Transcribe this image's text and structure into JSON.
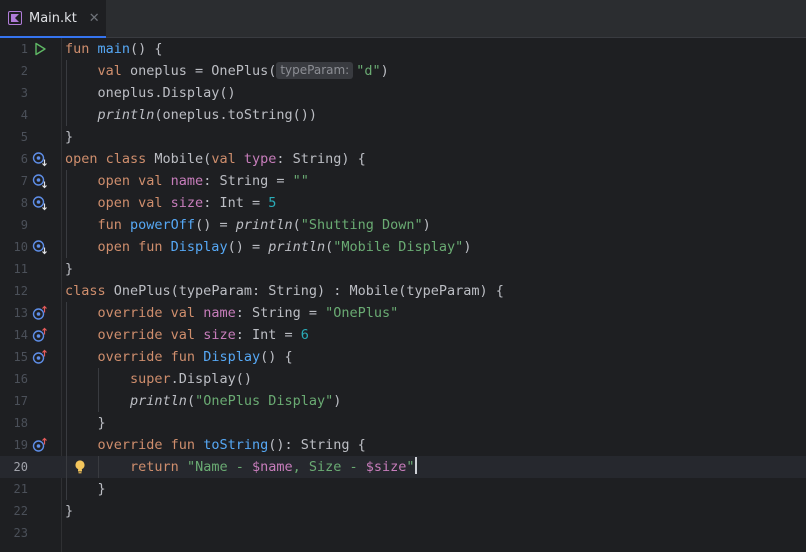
{
  "tab": {
    "filename": "Main.kt",
    "close_glyph": "✕"
  },
  "gutter_icons": {
    "run": "run-gutter-icon",
    "overridden": "overridden-by-icon",
    "overriding": "overrides-icon",
    "intention": "lightbulb-icon"
  },
  "colors": {
    "keyword": "#cf8e6d",
    "function": "#56a8f5",
    "property": "#c77dbb",
    "string": "#6aab73",
    "number": "#2aacb8",
    "text": "#bcbec4",
    "background": "#1e1f22"
  },
  "lines": [
    {
      "n": "1",
      "segments": [
        [
          "kw",
          "fun "
        ],
        [
          "fn",
          "main"
        ],
        [
          "",
          "() {"
        ]
      ]
    },
    {
      "n": "2",
      "segments": [
        [
          "",
          "    "
        ],
        [
          "kw",
          "val "
        ],
        [
          "",
          "oneplus = OnePlus("
        ],
        [
          "hint",
          "typeParam:"
        ],
        [
          "str",
          "\"d\""
        ],
        [
          "",
          ")"
        ]
      ]
    },
    {
      "n": "3",
      "segments": [
        [
          "",
          "    oneplus.Display()"
        ]
      ]
    },
    {
      "n": "4",
      "segments": [
        [
          "",
          "    "
        ],
        [
          "it",
          "println"
        ],
        [
          "",
          "(oneplus.toString())"
        ]
      ]
    },
    {
      "n": "5",
      "segments": [
        [
          "",
          "}"
        ]
      ]
    },
    {
      "n": "6",
      "segments": [
        [
          "kw",
          "open class "
        ],
        [
          "",
          "Mobile("
        ],
        [
          "kw",
          "val "
        ],
        [
          "prop",
          "type"
        ],
        [
          "",
          ": String) {"
        ]
      ]
    },
    {
      "n": "7",
      "segments": [
        [
          "",
          "    "
        ],
        [
          "kw",
          "open val "
        ],
        [
          "prop",
          "name"
        ],
        [
          "",
          ": String = "
        ],
        [
          "str",
          "\"\""
        ]
      ]
    },
    {
      "n": "8",
      "segments": [
        [
          "",
          "    "
        ],
        [
          "kw",
          "open val "
        ],
        [
          "prop",
          "size"
        ],
        [
          "",
          ": Int = "
        ],
        [
          "num",
          "5"
        ]
      ]
    },
    {
      "n": "9",
      "segments": [
        [
          "",
          "    "
        ],
        [
          "kw",
          "fun "
        ],
        [
          "fn",
          "powerOff"
        ],
        [
          "",
          "() = "
        ],
        [
          "it",
          "println"
        ],
        [
          "",
          "("
        ],
        [
          "str",
          "\"Shutting Down\""
        ],
        [
          "",
          ")"
        ]
      ]
    },
    {
      "n": "10",
      "segments": [
        [
          "",
          "    "
        ],
        [
          "kw",
          "open fun "
        ],
        [
          "fn",
          "Display"
        ],
        [
          "",
          "() = "
        ],
        [
          "it",
          "println"
        ],
        [
          "",
          "("
        ],
        [
          "str",
          "\"Mobile Display\""
        ],
        [
          "",
          ")"
        ]
      ]
    },
    {
      "n": "11",
      "segments": [
        [
          "",
          "}"
        ]
      ]
    },
    {
      "n": "12",
      "segments": [
        [
          "kw",
          "class "
        ],
        [
          "",
          "OnePlus(typeParam: String) : Mobile(typeParam) {"
        ]
      ]
    },
    {
      "n": "13",
      "segments": [
        [
          "",
          "    "
        ],
        [
          "kw",
          "override val "
        ],
        [
          "prop",
          "name"
        ],
        [
          "",
          ": String = "
        ],
        [
          "str",
          "\"OnePlus\""
        ]
      ]
    },
    {
      "n": "14",
      "segments": [
        [
          "",
          "    "
        ],
        [
          "kw",
          "override val "
        ],
        [
          "prop",
          "size"
        ],
        [
          "",
          ": Int = "
        ],
        [
          "num",
          "6"
        ]
      ]
    },
    {
      "n": "15",
      "segments": [
        [
          "",
          "    "
        ],
        [
          "kw",
          "override fun "
        ],
        [
          "fn",
          "Display"
        ],
        [
          "",
          "() {"
        ]
      ]
    },
    {
      "n": "16",
      "segments": [
        [
          "",
          "        "
        ],
        [
          "kw",
          "super"
        ],
        [
          "",
          ".Display()"
        ]
      ]
    },
    {
      "n": "17",
      "segments": [
        [
          "",
          "        "
        ],
        [
          "it",
          "println"
        ],
        [
          "",
          "("
        ],
        [
          "str",
          "\"OnePlus Display\""
        ],
        [
          "",
          ")"
        ]
      ]
    },
    {
      "n": "18",
      "segments": [
        [
          "",
          "    }"
        ]
      ]
    },
    {
      "n": "19",
      "segments": [
        [
          "",
          "    "
        ],
        [
          "kw",
          "override fun "
        ],
        [
          "fn",
          "toString"
        ],
        [
          "",
          "(): String {"
        ]
      ]
    },
    {
      "n": "20",
      "segments": [
        [
          "",
          "        "
        ],
        [
          "kw",
          "return "
        ],
        [
          "str",
          "\"Name - "
        ],
        [
          "tmpl",
          "$name"
        ],
        [
          "str",
          ", Size - "
        ],
        [
          "tmpl",
          "$size"
        ],
        [
          "str",
          "\""
        ],
        [
          "caret",
          ""
        ]
      ]
    },
    {
      "n": "21",
      "segments": [
        [
          "",
          "    }"
        ]
      ]
    },
    {
      "n": "22",
      "segments": [
        [
          "",
          "}"
        ]
      ]
    },
    {
      "n": "23",
      "segments": []
    }
  ],
  "gutter": {
    "1": "run",
    "6": "overridden",
    "7": "overridden",
    "8": "overridden",
    "10": "overridden",
    "13": "overriding",
    "14": "overriding",
    "15": "overriding",
    "19": "overriding"
  },
  "current_line": "20",
  "intention_line": "20"
}
